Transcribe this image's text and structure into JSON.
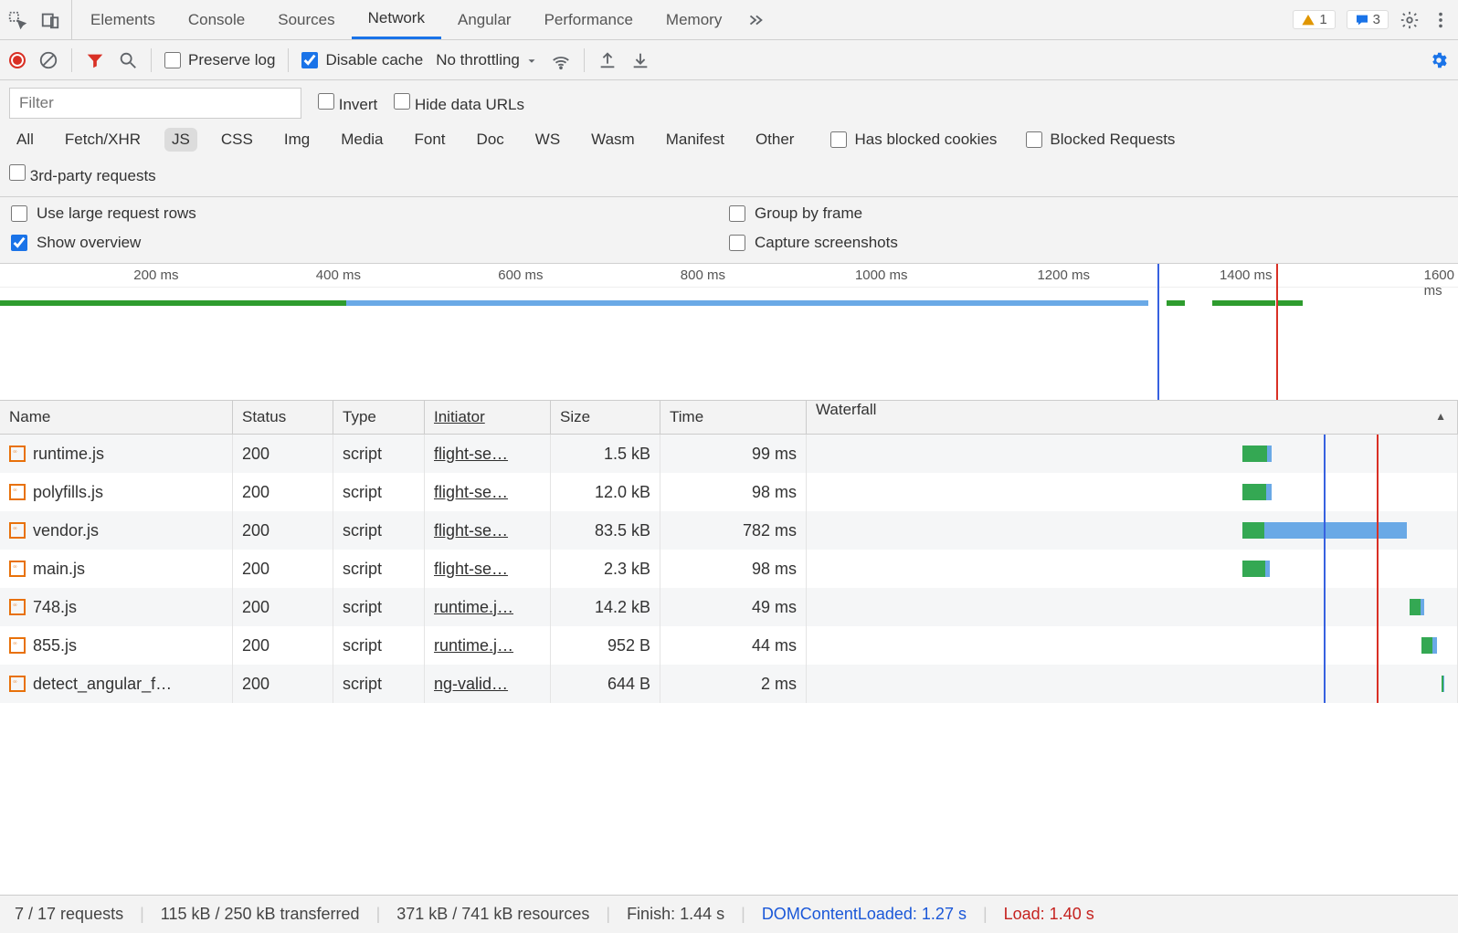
{
  "tabs": {
    "items": [
      "Elements",
      "Console",
      "Sources",
      "Network",
      "Angular",
      "Performance",
      "Memory"
    ],
    "active": "Network"
  },
  "badges": {
    "warn_count": "1",
    "err_count": "3"
  },
  "toolbar": {
    "preserve_log": "Preserve log",
    "disable_cache": "Disable cache",
    "disable_cache_checked": true,
    "throttling": "No throttling"
  },
  "filter": {
    "placeholder": "Filter",
    "invert": "Invert",
    "hide_data_urls": "Hide data URLs",
    "types": [
      "All",
      "Fetch/XHR",
      "JS",
      "CSS",
      "Img",
      "Media",
      "Font",
      "Doc",
      "WS",
      "Wasm",
      "Manifest",
      "Other"
    ],
    "types_selected": "JS",
    "has_blocked_cookies": "Has blocked cookies",
    "blocked_requests": "Blocked Requests",
    "third_party": "3rd-party requests"
  },
  "options": {
    "use_large_rows": "Use large request rows",
    "show_overview": "Show overview",
    "show_overview_checked": true,
    "group_by_frame": "Group by frame",
    "capture_screenshots": "Capture screenshots"
  },
  "overview": {
    "ticks": [
      "200 ms",
      "400 ms",
      "600 ms",
      "800 ms",
      "1000 ms",
      "1200 ms",
      "1400 ms",
      "1600 ms"
    ],
    "max_ms": 1600,
    "blue_cursor_ms": 1270,
    "red_cursor_ms": 1400
  },
  "columns": {
    "name": "Name",
    "status": "Status",
    "type": "Type",
    "initiator": "Initiator",
    "size": "Size",
    "time": "Time",
    "waterfall": "Waterfall"
  },
  "waterfall": {
    "max_ms": 1600,
    "blue_line_ms": 1270,
    "red_line_ms": 1400
  },
  "requests": [
    {
      "name": "runtime.js",
      "status": "200",
      "type": "script",
      "initiator": "flight-se…",
      "size": "1.5 kB",
      "time": "99 ms",
      "wf_start": 1070,
      "wf_green": 60,
      "wf_blue": 12
    },
    {
      "name": "polyfills.js",
      "status": "200",
      "type": "script",
      "initiator": "flight-se…",
      "size": "12.0 kB",
      "time": "98 ms",
      "wf_start": 1070,
      "wf_green": 58,
      "wf_blue": 14
    },
    {
      "name": "vendor.js",
      "status": "200",
      "type": "script",
      "initiator": "flight-se…",
      "size": "83.5 kB",
      "time": "782 ms",
      "wf_start": 1070,
      "wf_green": 55,
      "wf_blue": 350
    },
    {
      "name": "main.js",
      "status": "200",
      "type": "script",
      "initiator": "flight-se…",
      "size": "2.3 kB",
      "time": "98 ms",
      "wf_start": 1070,
      "wf_green": 56,
      "wf_blue": 12
    },
    {
      "name": "748.js",
      "status": "200",
      "type": "script",
      "initiator": "runtime.j…",
      "size": "14.2 kB",
      "time": "49 ms",
      "wf_start": 1480,
      "wf_green": 28,
      "wf_blue": 10
    },
    {
      "name": "855.js",
      "status": "200",
      "type": "script",
      "initiator": "runtime.j…",
      "size": "952 B",
      "time": "44 ms",
      "wf_start": 1510,
      "wf_green": 28,
      "wf_blue": 10
    },
    {
      "name": "detect_angular_f…",
      "status": "200",
      "type": "script",
      "initiator": "ng-valid…",
      "size": "644 B",
      "time": "2 ms",
      "wf_start": 1560,
      "wf_green": 4,
      "wf_blue": 2
    }
  ],
  "status": {
    "requests": "7 / 17 requests",
    "transferred": "115 kB / 250 kB transferred",
    "resources": "371 kB / 741 kB resources",
    "finish": "Finish: 1.44 s",
    "dcl": "DOMContentLoaded: 1.27 s",
    "load": "Load: 1.40 s"
  }
}
